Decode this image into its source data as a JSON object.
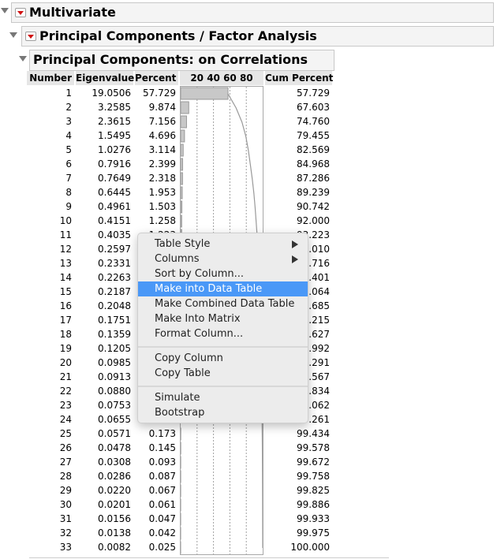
{
  "sections": {
    "multivariate": "Multivariate",
    "pca": "Principal Components / Factor Analysis",
    "on_corr": "Principal Components: on Correlations"
  },
  "table": {
    "headers": {
      "number": "Number",
      "eigenvalue": "Eigenvalue",
      "percent": "Percent",
      "chart": "20 40 60 80",
      "cum": "Cum Percent"
    },
    "rows": [
      [
        "1",
        "19.0506",
        "57.729",
        "57.729"
      ],
      [
        "2",
        "3.2585",
        "9.874",
        "67.603"
      ],
      [
        "3",
        "2.3615",
        "7.156",
        "74.760"
      ],
      [
        "4",
        "1.5495",
        "4.696",
        "79.455"
      ],
      [
        "5",
        "1.0276",
        "3.114",
        "82.569"
      ],
      [
        "6",
        "0.7916",
        "2.399",
        "84.968"
      ],
      [
        "7",
        "0.7649",
        "2.318",
        "87.286"
      ],
      [
        "8",
        "0.6445",
        "1.953",
        "89.239"
      ],
      [
        "9",
        "0.4961",
        "1.503",
        "90.742"
      ],
      [
        "10",
        "0.4151",
        "1.258",
        "92.000"
      ],
      [
        "11",
        "0.4035",
        "1.223",
        "93.223"
      ],
      [
        "12",
        "0.2597",
        "",
        "94.010"
      ],
      [
        "13",
        "0.2331",
        "",
        "94.716"
      ],
      [
        "14",
        "0.2263",
        "",
        "95.401"
      ],
      [
        "15",
        "0.2187",
        "",
        "96.064"
      ],
      [
        "16",
        "0.2048",
        "",
        "96.685"
      ],
      [
        "17",
        "0.1751",
        "",
        "97.215"
      ],
      [
        "18",
        "0.1359",
        "",
        "97.627"
      ],
      [
        "19",
        "0.1205",
        "",
        "97.992"
      ],
      [
        "20",
        "0.0985",
        "",
        "98.291"
      ],
      [
        "21",
        "0.0913",
        "",
        "98.567"
      ],
      [
        "22",
        "0.0880",
        "",
        "98.834"
      ],
      [
        "23",
        "0.0753",
        "",
        "99.062"
      ],
      [
        "24",
        "0.0655",
        "",
        "99.261"
      ],
      [
        "25",
        "0.0571",
        "0.173",
        "99.434"
      ],
      [
        "26",
        "0.0478",
        "0.145",
        "99.578"
      ],
      [
        "27",
        "0.0308",
        "0.093",
        "99.672"
      ],
      [
        "28",
        "0.0286",
        "0.087",
        "99.758"
      ],
      [
        "29",
        "0.0220",
        "0.067",
        "99.825"
      ],
      [
        "30",
        "0.0201",
        "0.061",
        "99.886"
      ],
      [
        "31",
        "0.0156",
        "0.047",
        "99.933"
      ],
      [
        "32",
        "0.0138",
        "0.042",
        "99.975"
      ],
      [
        "33",
        "0.0082",
        "0.025",
        "100.000"
      ]
    ],
    "chart_ticks": [
      20,
      40,
      60,
      80
    ],
    "chart_range": [
      0,
      100
    ],
    "colors": {
      "bar": "#c8c8c8",
      "curve": "#999999",
      "grid": "#a0a0a0"
    }
  },
  "context_menu": {
    "items": [
      {
        "label": "Table Style",
        "submenu": true
      },
      {
        "label": "Columns",
        "submenu": true
      },
      {
        "label": "Sort by Column..."
      },
      {
        "label": "Make into Data Table",
        "highlighted": true
      },
      {
        "label": "Make Combined Data Table"
      },
      {
        "label": "Make Into Matrix"
      },
      {
        "label": "Format Column..."
      },
      {
        "separator": true
      },
      {
        "label": "Copy Column"
      },
      {
        "label": "Copy Table"
      },
      {
        "separator": true
      },
      {
        "label": "Simulate"
      },
      {
        "label": "Bootstrap"
      }
    ],
    "highlight_color": "#4a98f7"
  }
}
